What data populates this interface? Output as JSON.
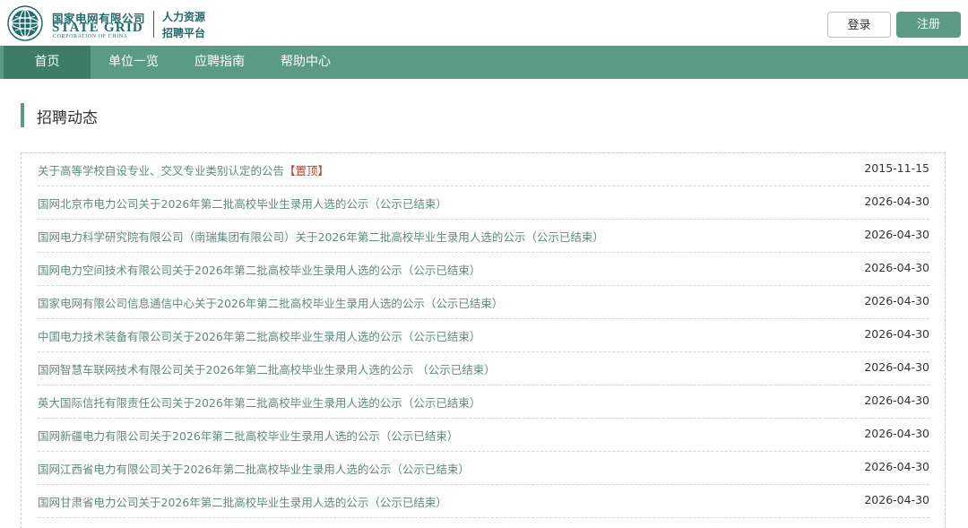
{
  "header": {
    "company_cn": "国家电网有限公司",
    "company_en": "STATE GRID",
    "company_en_sub": "CORPORATION OF CHINA",
    "platform_line1": "人力资源",
    "platform_line2": "招聘平台",
    "login_label": "登录",
    "register_label": "注册"
  },
  "colors": {
    "brand_green": "#5b9a84",
    "nav_active": "#3e7c67",
    "link_text": "#5f8a80",
    "tag_red": "#c0392b"
  },
  "nav": {
    "items": [
      {
        "label": "首页",
        "active": true
      },
      {
        "label": "单位一览",
        "active": false
      },
      {
        "label": "应聘指南",
        "active": false
      },
      {
        "label": "帮助中心",
        "active": false
      }
    ]
  },
  "section": {
    "title": "招聘动态"
  },
  "news": [
    {
      "title": "关于高等学校自设专业、交叉专业类别认定的公告",
      "tag": "【置顶】",
      "date": "2015-11-15"
    },
    {
      "title": "国网北京市电力公司关于2026年第二批高校毕业生录用人选的公示（公示已结束）",
      "date": "2026-04-30"
    },
    {
      "title": "国网电力科学研究院有限公司（南瑞集团有限公司）关于2026年第二批高校毕业生录用人选的公示（公示已结束）",
      "date": "2026-04-30"
    },
    {
      "title": "国网电力空间技术有限公司关于2026年第二批高校毕业生录用人选的公示（公示已结束）",
      "date": "2026-04-30"
    },
    {
      "title": "国家电网有限公司信息通信中心关于2026年第二批高校毕业生录用人选的公示（公示已结束）",
      "date": "2026-04-30"
    },
    {
      "title": "中国电力技术装备有限公司关于2026年第二批高校毕业生录用人选的公示（公示已结束）",
      "date": "2026-04-30"
    },
    {
      "title": "国网智慧车联网技术有限公司关于2026年第二批高校毕业生录用人选的公示 （公示已结束）",
      "date": "2026-04-30"
    },
    {
      "title": "英大国际信托有限责任公司关于2026年第二批高校毕业生录用人选的公示（公示已结束）",
      "date": "2026-04-30"
    },
    {
      "title": "国网新疆电力有限公司关于2026年第二批高校毕业生录用人选的公示（公示已结束）",
      "date": "2026-04-30"
    },
    {
      "title": "国网江西省电力有限公司关于2026年第二批高校毕业生录用人选的公示（公示已结束）",
      "date": "2026-04-30"
    },
    {
      "title": "国网甘肃省电力公司关于2026年第二批高校毕业生录用人选的公示（公示已结束）",
      "date": "2026-04-30"
    }
  ]
}
